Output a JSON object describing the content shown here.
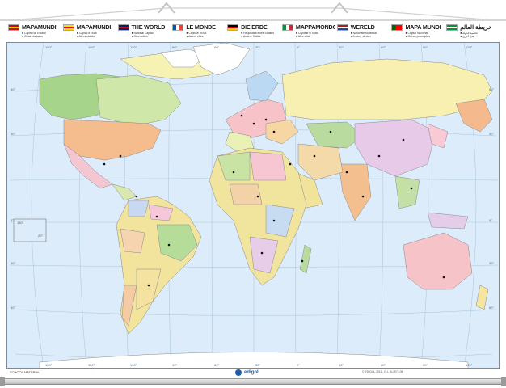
{
  "colors": {
    "ocean": "#dcecfa",
    "frame": "#7a8a99",
    "brand": "#1c5fa8"
  },
  "legend": [
    {
      "title": "MAPAMUNDI",
      "lines": [
        "Capital de Estado",
        "Otras ciudades"
      ],
      "flag": [
        "#c60b1e",
        "#ffc400",
        "#c60b1e"
      ]
    },
    {
      "title": "MAPAMUNDI",
      "lines": [
        "Capital d'Estat",
        "Altres ciutats"
      ],
      "flag": [
        "#fcdd09",
        "#da121a",
        "#fcdd09"
      ]
    },
    {
      "title": "THE WORLD",
      "lines": [
        "National Capital",
        "Other cities"
      ],
      "flag": [
        "#012169",
        "#c8102e",
        "#012169"
      ]
    },
    {
      "title": "LE MONDE",
      "lines": [
        "Capitale d'Etat",
        "Autres villes"
      ],
      "flag": [
        "#0055a4",
        "#ffffff",
        "#ef4135"
      ],
      "vertical": true
    },
    {
      "title": "DIE ERDE",
      "lines": [
        "Hauptstadt eines Staates",
        "Andere Städte"
      ],
      "flag": [
        "#000000",
        "#dd0000",
        "#ffce00"
      ]
    },
    {
      "title": "MAPPAMONDO",
      "lines": [
        "Capitale di Stato",
        "Altre città"
      ],
      "flag": [
        "#009246",
        "#ffffff",
        "#ce2b37"
      ],
      "vertical": true
    },
    {
      "title": "WERELD",
      "lines": [
        "Nationale hoofdstad",
        "Andere steden"
      ],
      "flag": [
        "#ae1c28",
        "#ffffff",
        "#21468b"
      ]
    },
    {
      "title": "MAPA MUNDI",
      "lines": [
        "Capital Nacional",
        "Outras povoações"
      ],
      "flag": [
        "#006600",
        "#ff0000",
        "#ff0000"
      ],
      "vertical": true
    },
    {
      "title": "خريطة العالم",
      "lines": [
        "عاصمة الدولة",
        "مدن أخرى"
      ],
      "flag": [
        "#009639",
        "#ffffff",
        "#009639"
      ]
    }
  ],
  "footer": {
    "left": "SCHOOL MATERIAL",
    "brand": "edigol",
    "ref": "© EDIGOL 2011 - D.L. B-3574-08"
  },
  "map": {
    "longitude_labels": [
      "180°",
      "150°",
      "120°",
      "90°",
      "60°",
      "30°",
      "0°",
      "30°",
      "60°",
      "90°",
      "120°",
      "150°",
      "180°"
    ],
    "latitude_labels": [
      "60°",
      "30°",
      "0°",
      "30°",
      "60°"
    ],
    "inset_labels": [
      "150°",
      "20°"
    ]
  }
}
